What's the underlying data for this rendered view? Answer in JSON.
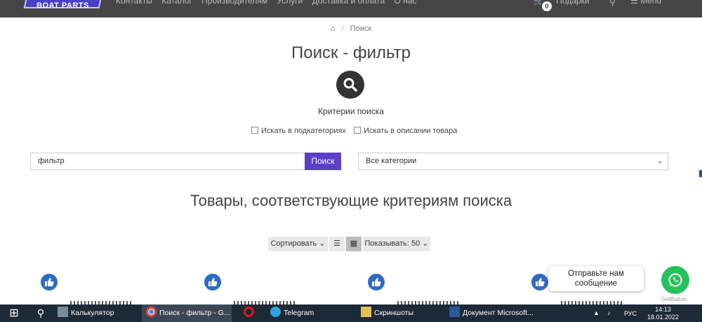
{
  "header": {
    "logo_text": "BOAT PARTS",
    "nav": [
      "Контакты",
      "Каталог",
      "Производителям",
      "Услуги",
      "Доставка и оплата",
      "О нас"
    ],
    "cart_count": "0",
    "cart_label": "Подарки",
    "menu_label": "Menu"
  },
  "breadcrumb": {
    "current": "Поиск"
  },
  "page_title": "Поиск - фильтр",
  "criteria_title": "Критерии поиска",
  "checkboxes": [
    {
      "label": "Искать в подкатегориях",
      "checked": false
    },
    {
      "label": "Искать в описании товара",
      "checked": false
    }
  ],
  "search": {
    "value": "фильтр",
    "button": "Поиск"
  },
  "category_select": {
    "selected": "Все категории"
  },
  "results_title": "Товары, соответствующие критериям поиска",
  "toolbar": {
    "sort_label": "Сортировать",
    "show_label": "Показывать: 50"
  },
  "chat": {
    "bubble_text": "Отправьте нам сообщение",
    "powered": "GetButton"
  },
  "taskbar": {
    "items": [
      "Калькулятор",
      "Поиск - фильтр - G...",
      "",
      "Telegram",
      "Скриншоты",
      "Документ Microsoft..."
    ],
    "lang": "РУС",
    "time": "14:13",
    "date": "18.01.2022"
  },
  "colors": {
    "accent": "#5b3fc9",
    "header": "#454545",
    "thumb": "#2e6bc4",
    "whatsapp": "#25c15b"
  }
}
